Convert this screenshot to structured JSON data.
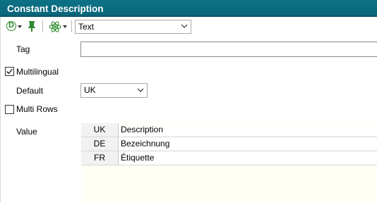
{
  "window": {
    "title": "Constant Description"
  },
  "toolbar": {
    "d_icon_glyph": "D",
    "type_select": {
      "value": "Text"
    }
  },
  "form": {
    "tag": {
      "label": "Tag",
      "value": ""
    },
    "multilingual": {
      "label": "Multilingual",
      "checked": true
    },
    "default": {
      "label": "Default",
      "value": "UK"
    },
    "multi_rows": {
      "label": "Multi Rows",
      "checked": false
    },
    "value": {
      "label": "Value",
      "rows": [
        {
          "lang": "UK",
          "text": "Description"
        },
        {
          "lang": "DE",
          "text": "Bezeichnung"
        },
        {
          "lang": "FR",
          "text": "Étiquette"
        }
      ]
    }
  },
  "colors": {
    "title_bar": "#0a6478",
    "icon_green": "#2e8b2e",
    "grid_background": "#fffff5"
  }
}
